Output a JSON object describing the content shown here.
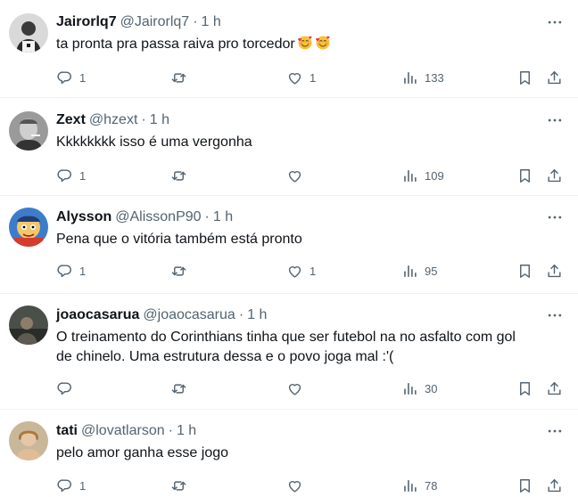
{
  "replies": [
    {
      "display_name": "Jairorlq7",
      "handle": "@Jairorlq7",
      "separator": "·",
      "time": "1 h",
      "text": "ta pronta pra passa raiva pro torcedor",
      "emojis": [
        "smiling-face-with-hearts",
        "smiling-face-with-hearts"
      ],
      "reply_count": "1",
      "retweet_count": "",
      "like_count": "1",
      "view_count": "133"
    },
    {
      "display_name": "Zext",
      "handle": "@hzext",
      "separator": "·",
      "time": "1 h",
      "text": "Kkkkkkkk isso é uma vergonha",
      "reply_count": "1",
      "retweet_count": "",
      "like_count": "",
      "view_count": "109"
    },
    {
      "display_name": "Alysson",
      "handle": "@AlissonP90",
      "separator": "·",
      "time": "1 h",
      "text": "Pena que o vitória também está pronto",
      "reply_count": "1",
      "retweet_count": "",
      "like_count": "1",
      "view_count": "95"
    },
    {
      "display_name": "joaocasarua",
      "handle": "@joaocasarua",
      "separator": "·",
      "time": "1 h",
      "text_line1": "O treinamento do Corinthians tinha que ser futebol na no asfalto com gol",
      "text_line2": "de chinelo. Uma estrutura dessa e o povo joga mal :'(",
      "reply_count": "",
      "retweet_count": "",
      "like_count": "",
      "view_count": "30"
    },
    {
      "display_name": "tati",
      "handle": "@lovatlarson",
      "separator": "·",
      "time": "1 h",
      "text": "pelo amor ganha esse jogo",
      "reply_count": "1",
      "retweet_count": "",
      "like_count": "",
      "view_count": "78"
    }
  ],
  "icons": {
    "reply": "reply-icon",
    "retweet": "retweet-icon",
    "like": "heart-icon",
    "views": "views-icon",
    "bookmark": "bookmark-icon",
    "share": "share-icon",
    "more": "more-icon"
  },
  "colors": {
    "text": "#0f1419",
    "secondary": "#536471",
    "divider": "#eff3f4"
  }
}
